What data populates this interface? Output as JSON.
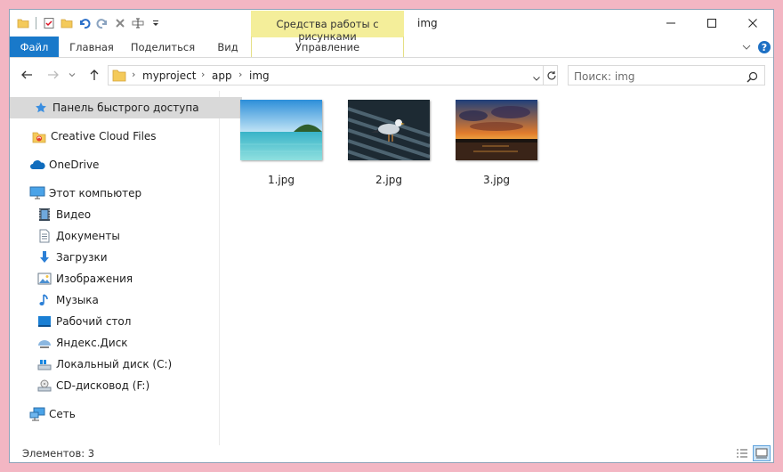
{
  "window": {
    "title": "img",
    "context_tab": "Средства работы с рисунками"
  },
  "ribbon": {
    "tabs": [
      "Файл",
      "Главная",
      "Поделиться",
      "Вид",
      "Управление"
    ]
  },
  "address": {
    "path": [
      "myproject",
      "app",
      "img"
    ]
  },
  "search": {
    "placeholder": "Поиск: img"
  },
  "sidebar": {
    "items": [
      {
        "label": "Панель быстрого доступа",
        "icon": "star-icon"
      },
      {
        "label": "Creative Cloud Files",
        "icon": "creative-cloud-icon"
      },
      {
        "label": "OneDrive",
        "icon": "onedrive-cloud-icon"
      },
      {
        "label": "Этот компьютер",
        "icon": "computer-icon"
      },
      {
        "label": "Видео",
        "icon": "video-icon"
      },
      {
        "label": "Документы",
        "icon": "documents-icon"
      },
      {
        "label": "Загрузки",
        "icon": "downloads-icon"
      },
      {
        "label": "Изображения",
        "icon": "pictures-icon"
      },
      {
        "label": "Музыка",
        "icon": "music-icon"
      },
      {
        "label": "Рабочий стол",
        "icon": "desktop-icon"
      },
      {
        "label": "Яндекс.Диск",
        "icon": "yandex-disk-icon"
      },
      {
        "label": "Локальный диск (C:)",
        "icon": "local-disk-icon"
      },
      {
        "label": "CD-дисковод (F:)",
        "icon": "cd-drive-icon"
      },
      {
        "label": "Сеть",
        "icon": "network-icon"
      }
    ]
  },
  "files": [
    {
      "name": "1.jpg"
    },
    {
      "name": "2.jpg"
    },
    {
      "name": "3.jpg"
    }
  ],
  "status": {
    "count": "Элементов: 3"
  },
  "colors": {
    "file_tab": "#1979ca",
    "context_tab": "#f4ee9a",
    "selected_nav": "#d9d9d9",
    "outer_bg": "#f3b6c3"
  }
}
